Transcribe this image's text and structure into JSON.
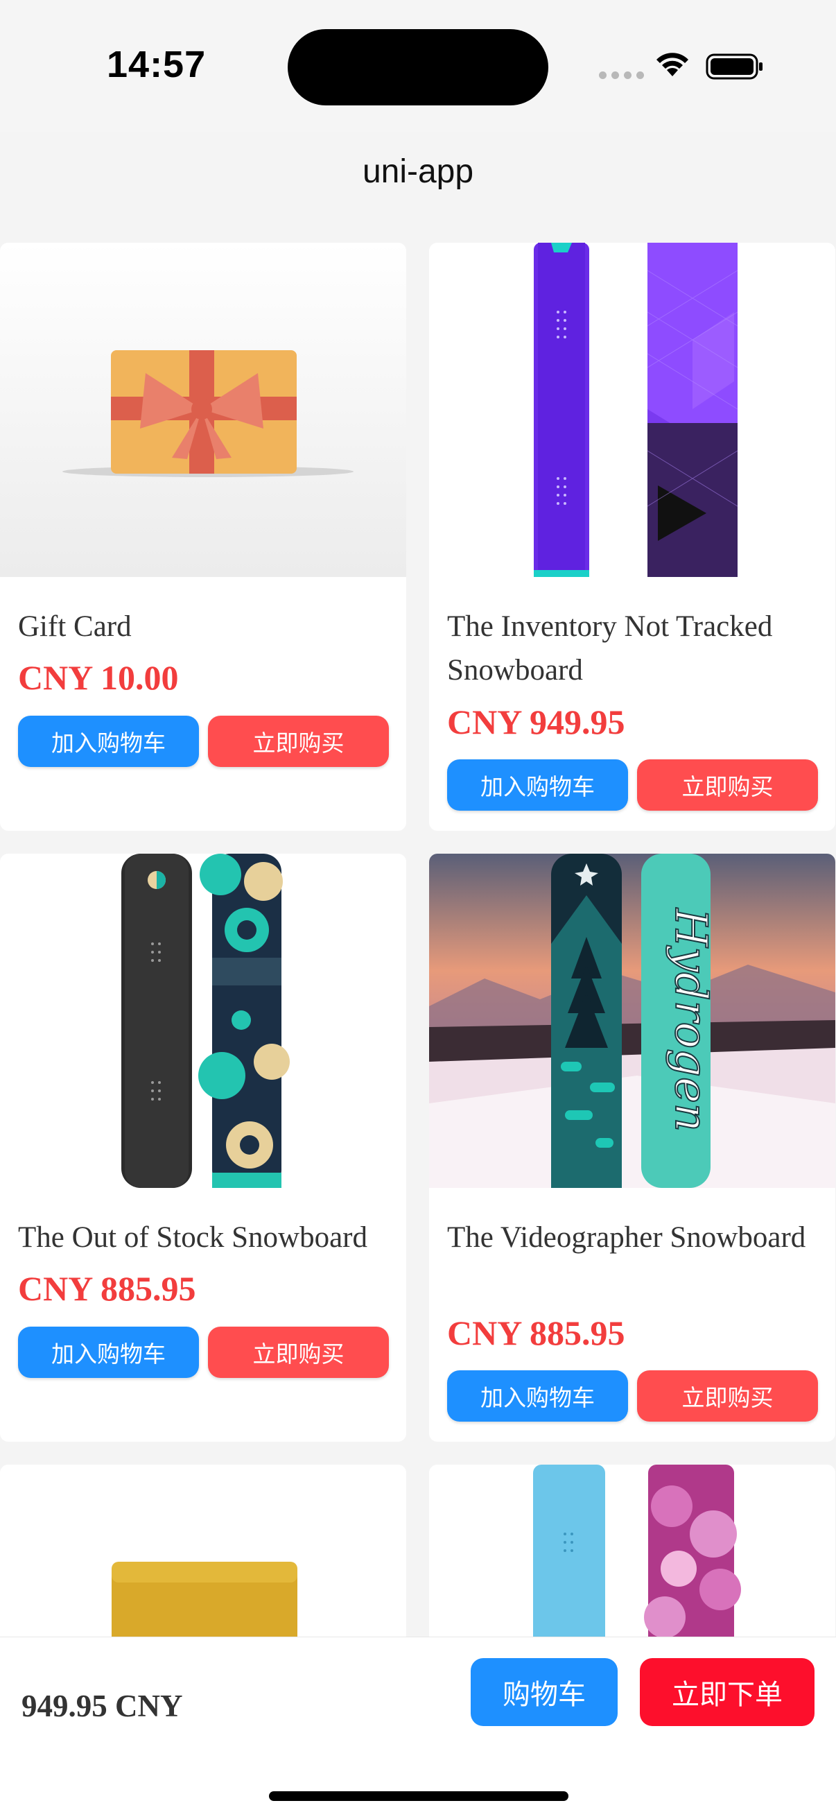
{
  "status_bar": {
    "time": "14:57"
  },
  "nav": {
    "title": "uni-app"
  },
  "products": [
    {
      "title": "Gift Card",
      "price": "CNY 10.00",
      "add_to_cart_label": "加入购物车",
      "buy_now_label": "立即购买",
      "image": "gift-card-image"
    },
    {
      "title": "The Inventory Not Tracked Snowboard",
      "price": "CNY 949.95",
      "add_to_cart_label": "加入购物车",
      "buy_now_label": "立即购买",
      "image": "purple-snowboard-image"
    },
    {
      "title": "The Out of Stock Snowboard",
      "price": "CNY 885.95",
      "add_to_cart_label": "加入购物车",
      "buy_now_label": "立即购买",
      "image": "black-teal-snowboard-image"
    },
    {
      "title": "The Videographer Snowboard",
      "price": "CNY 885.95",
      "add_to_cart_label": "加入购物车",
      "buy_now_label": "立即购买",
      "image": "hydrogen-snowboard-image"
    },
    {
      "image": "wax-bar-image"
    },
    {
      "image": "blue-pink-snowboard-image"
    }
  ],
  "bottom_bar": {
    "total": "949.95 CNY",
    "cart_label": "购物车",
    "order_label": "立即下单"
  },
  "colors": {
    "primary_blue": "#1e90ff",
    "buy_red": "#ff4d4f",
    "order_red": "#fd0f2c",
    "price_red": "#f23d3d"
  }
}
